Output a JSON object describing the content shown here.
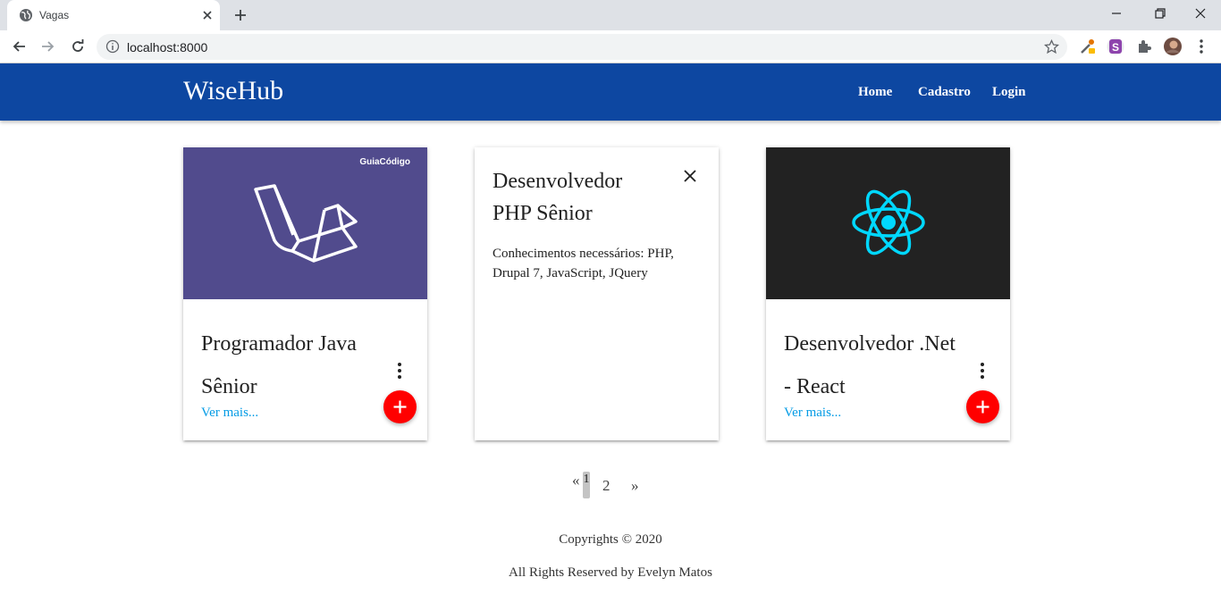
{
  "browser": {
    "tab_title": "Vagas",
    "url": "localhost:8000"
  },
  "header": {
    "brand": "WiseHub",
    "nav": [
      "Home",
      "Cadastro",
      "Login"
    ],
    "bg_color": "#0d47a1"
  },
  "cards": [
    {
      "image_badge": "GuiaCódigo",
      "image_icon": "laravel-logo",
      "image_bg": "#514b8d",
      "title": "Programador Java Sênior",
      "link": "Ver mais..."
    },
    {
      "state": "revealed",
      "title": "Desenvolvedor PHP Sênior",
      "text": "Conhecimentos necessários: PHP, Drupal 7, JavaScript, JQuery"
    },
    {
      "image_icon": "react-logo",
      "image_bg": "#222222",
      "title": "Desenvolvedor .Net - React",
      "link": "Ver mais..."
    }
  ],
  "pagination": {
    "prev": "«",
    "pages": [
      "1",
      "2"
    ],
    "active": "1",
    "next": "»"
  },
  "footer": {
    "copyright": "Copyrights © 2020",
    "rights": "All Rights Reserved by Evelyn Matos"
  },
  "colors": {
    "fab": "#ff0000",
    "link": "#039be5"
  }
}
